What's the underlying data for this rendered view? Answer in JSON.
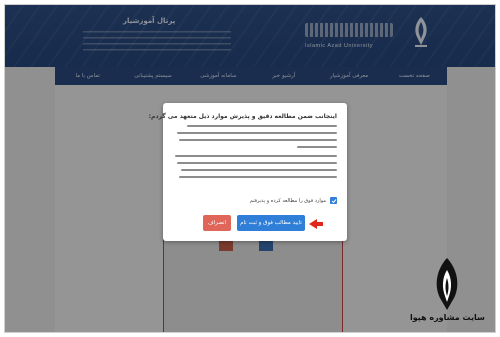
{
  "header": {
    "portal_title": "پرتال آموزشیار",
    "logo_sub": "Islamic Azad University"
  },
  "nav": [
    {
      "label": "صفحه نخست"
    },
    {
      "label": "معرفی آموزشیار"
    },
    {
      "label": "آرشیو خبر"
    },
    {
      "label": "سامانه آموزشی"
    },
    {
      "label": "سیستم پشتیبانی"
    },
    {
      "label": "تماس با ما"
    }
  ],
  "modal": {
    "heading": "اینجانب ضمن مطالعه دقیق و پذیرش موارد ذیل متعهد می گردم:",
    "checkbox_checked": true,
    "checkbox_label": "موارد فوق را مطالعه کرده و پذیرفتم",
    "accept_label": "تایید مطالب فوق و ثبت نام",
    "cancel_label": "انصراف",
    "accent_color": "#2f7fd8",
    "cancel_color": "#e0665a"
  },
  "icons": {
    "emblem": "university-emblem-icon",
    "pointer": "red-arrow-icon",
    "check": "check-icon"
  },
  "watermark": {
    "caption": "سایت مشاوره هپوا"
  }
}
